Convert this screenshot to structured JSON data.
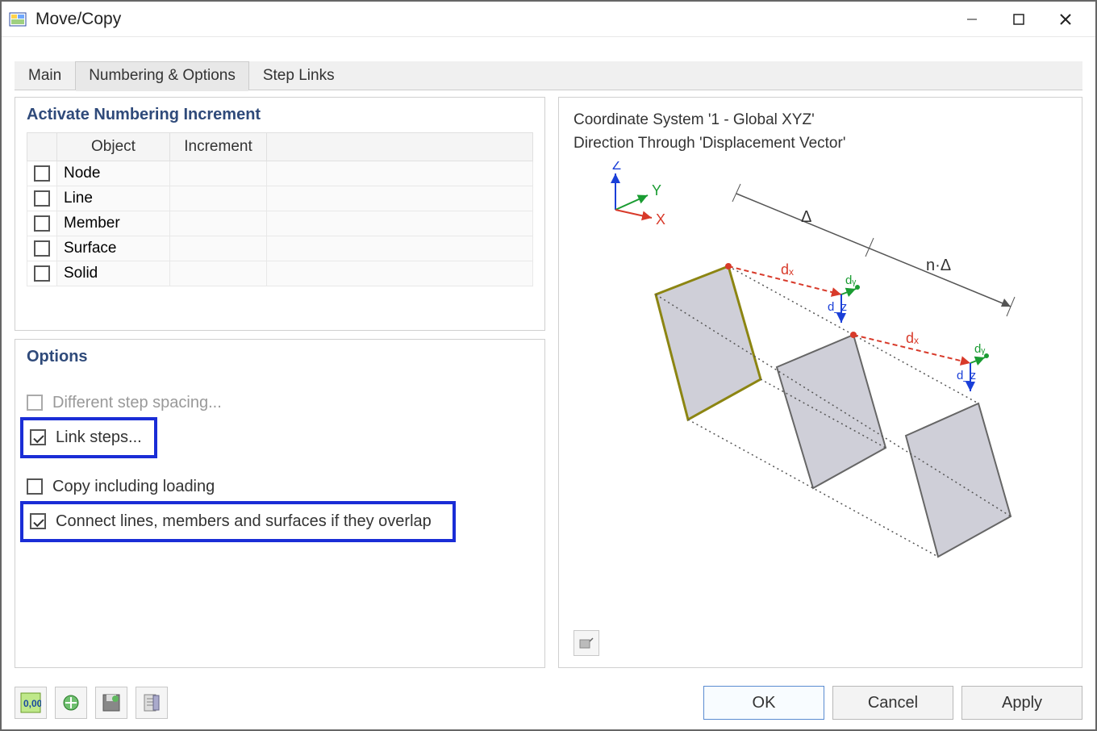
{
  "window": {
    "title": "Move/Copy"
  },
  "tabs": [
    {
      "label": "Main"
    },
    {
      "label": "Numbering & Options"
    },
    {
      "label": "Step Links"
    }
  ],
  "numbering": {
    "title": "Activate Numbering Increment",
    "columns": {
      "object": "Object",
      "increment": "Increment"
    },
    "rows": [
      {
        "object": "Node"
      },
      {
        "object": "Line"
      },
      {
        "object": "Member"
      },
      {
        "object": "Surface"
      },
      {
        "object": "Solid"
      }
    ]
  },
  "options": {
    "title": "Options",
    "different_step_spacing": "Different step spacing...",
    "link_steps": "Link steps...",
    "copy_including_loading": "Copy including loading",
    "connect_overlap": "Connect lines, members and surfaces if they overlap"
  },
  "preview": {
    "coord_system": "Coordinate System '1 - Global XYZ'",
    "direction": "Direction Through 'Displacement Vector'",
    "axes": {
      "z": "Z",
      "y": "Y",
      "x": "X"
    },
    "delta": "Δ",
    "ndelta": "n·Δ",
    "dx": "dₓ",
    "dy": "dᵧ",
    "dz": "d_z"
  },
  "buttons": {
    "ok": "OK",
    "cancel": "Cancel",
    "apply": "Apply"
  }
}
